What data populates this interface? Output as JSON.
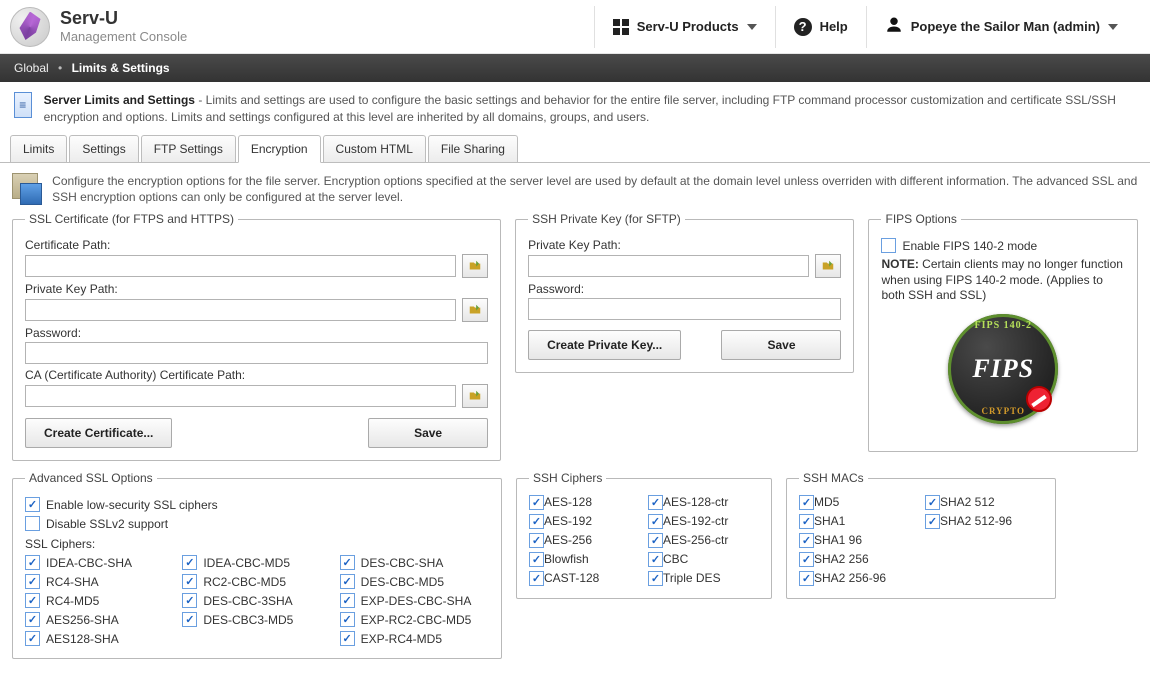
{
  "app": {
    "title": "Serv-U",
    "subtitle": "Management Console"
  },
  "topnav": {
    "products": "Serv-U Products",
    "help": "Help",
    "user": "Popeye the Sailor Man (admin)"
  },
  "breadcrumb": {
    "root": "Global",
    "current": "Limits & Settings"
  },
  "page": {
    "heading": "Server Limits and Settings",
    "blurb": " - Limits and settings are used to configure the basic settings and behavior for the entire file server, including FTP command processor customization and certificate  SSL/SSH encryption and  options. Limits and settings configured at this level are inherited by all domains, groups, and users."
  },
  "tabs": [
    "Limits",
    "Settings",
    "FTP Settings",
    "Encryption",
    "Custom HTML",
    "File Sharing"
  ],
  "activeTab": "Encryption",
  "tabDesc": "Configure the encryption options for the file server. Encryption options specified at the server level are used by default at the domain level unless overriden with different information. The advanced SSL and SSH   encryption options can only be configured at the server level.",
  "ssl": {
    "legend": "SSL Certificate (for FTPS and HTTPS)",
    "certPathLabel": "Certificate Path:",
    "privKeyLabel": "Private Key Path:",
    "passwordLabel": "Password:",
    "caPathLabel": "CA (Certificate Authority) Certificate Path:",
    "createBtn": "Create Certificate...",
    "saveBtn": "Save"
  },
  "sshKey": {
    "legend": "SSH Private Key (for SFTP)",
    "privKeyLabel": "Private Key Path:",
    "passwordLabel": "Password:",
    "createBtn": "Create Private Key...",
    "saveBtn": "Save"
  },
  "fips": {
    "legend": "FIPS Options",
    "enableLabel": "Enable FIPS 140-2 mode",
    "enableChecked": false,
    "noteBold": "NOTE:",
    "noteText": " Certain clients may no longer function when using FIPS 140-2 mode. (Applies to both SSH and SSL)",
    "logoMain": "FIPS",
    "logoTop": "FIPS 140-2",
    "logoBottom": "CRYPTO"
  },
  "advSsl": {
    "legend": "Advanced SSL Options",
    "lowSecLabel": "Enable low-security SSL ciphers",
    "lowSecChecked": true,
    "disableV2Label": "Disable SSLv2 support",
    "disableV2Checked": false,
    "ciphersHeader": "SSL Ciphers:",
    "ciphers": [
      {
        "name": "IDEA-CBC-SHA",
        "checked": true
      },
      {
        "name": "IDEA-CBC-MD5",
        "checked": true
      },
      {
        "name": "DES-CBC-SHA",
        "checked": true
      },
      {
        "name": "RC4-SHA",
        "checked": true
      },
      {
        "name": "RC2-CBC-MD5",
        "checked": true
      },
      {
        "name": "DES-CBC-MD5",
        "checked": true
      },
      {
        "name": "RC4-MD5",
        "checked": true
      },
      {
        "name": "DES-CBC-3SHA",
        "checked": true
      },
      {
        "name": "EXP-DES-CBC-SHA",
        "checked": true
      },
      {
        "name": "AES256-SHA",
        "checked": true
      },
      {
        "name": "DES-CBC3-MD5",
        "checked": true
      },
      {
        "name": "EXP-RC2-CBC-MD5",
        "checked": true
      },
      {
        "name": "AES128-SHA",
        "checked": true
      },
      {
        "name": "",
        "checked": false
      },
      {
        "name": "EXP-RC4-MD5",
        "checked": true
      }
    ]
  },
  "sshCiphers": {
    "legend": "SSH Ciphers",
    "items": [
      {
        "name": "AES-128",
        "checked": true
      },
      {
        "name": "AES-128-ctr",
        "checked": true
      },
      {
        "name": "AES-192",
        "checked": true
      },
      {
        "name": "AES-192-ctr",
        "checked": true
      },
      {
        "name": "AES-256",
        "checked": true
      },
      {
        "name": "AES-256-ctr",
        "checked": true
      },
      {
        "name": "Blowfish",
        "checked": true
      },
      {
        "name": "CBC",
        "checked": true
      },
      {
        "name": "CAST-128",
        "checked": true
      },
      {
        "name": "Triple DES",
        "checked": true
      }
    ]
  },
  "sshMacs": {
    "legend": "SSH MACs",
    "items": [
      {
        "name": "MD5",
        "checked": true
      },
      {
        "name": "SHA2 512",
        "checked": true
      },
      {
        "name": "SHA1",
        "checked": true
      },
      {
        "name": "SHA2 512-96",
        "checked": true
      },
      {
        "name": "SHA1 96",
        "checked": true
      },
      {
        "name": "",
        "checked": false
      },
      {
        "name": "SHA2 256",
        "checked": true
      },
      {
        "name": "",
        "checked": false
      },
      {
        "name": "SHA2 256-96",
        "checked": true
      },
      {
        "name": "",
        "checked": false
      }
    ]
  }
}
